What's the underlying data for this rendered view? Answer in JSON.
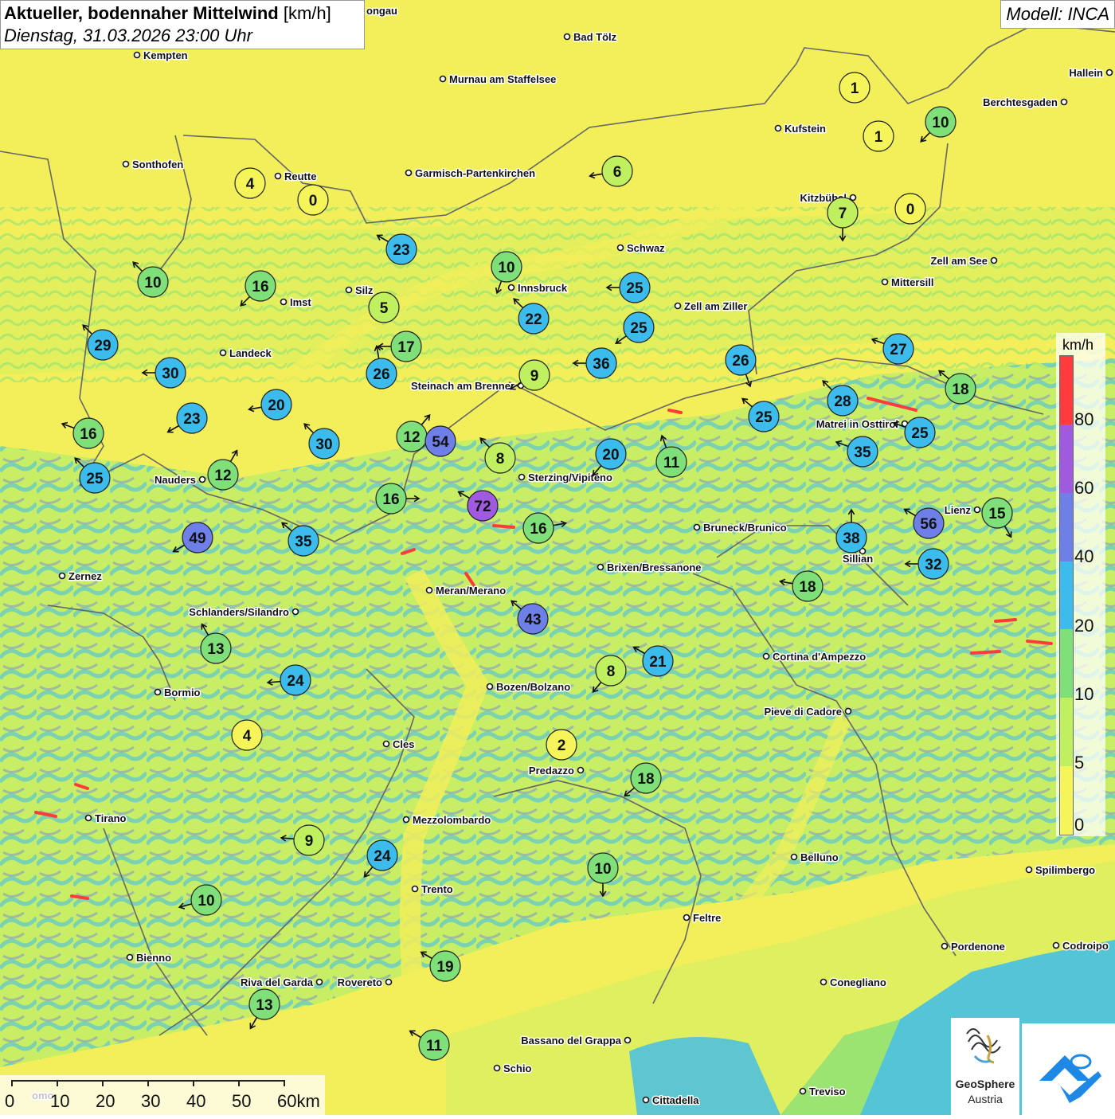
{
  "title": {
    "main": "Aktueller, bodennaher Mittelwind",
    "unit": "[km/h]",
    "datetime": "Dienstag, 31.03.2026 23:00 Uhr"
  },
  "model_label": "Modell: INCA",
  "legend": {
    "title": "km/h",
    "ticks": [
      "0",
      "5",
      "10",
      "20",
      "40",
      "60",
      "80"
    ],
    "colors": [
      "#f5f55a",
      "#bff060",
      "#7fe07a",
      "#3cbcec",
      "#6f7fe8",
      "#9f5ae0",
      "#ff3b3b"
    ]
  },
  "scale_bar": {
    "labels": [
      "0",
      "10",
      "20",
      "30",
      "40",
      "50",
      "60km"
    ]
  },
  "logo": {
    "name": "GeoSphere",
    "sub": "Austria"
  },
  "partial_labels": [
    "ongau",
    "omo"
  ],
  "cities": [
    "Kempten",
    "Bad Tölz",
    "Murnau am Staffelsee",
    "Hallein",
    "Berchtesgaden",
    "Kufstein",
    "Sonthofen",
    "Reutte",
    "Garmisch-Partenkirchen",
    "Kitzbühel",
    "Schwaz",
    "Zell am See",
    "Mittersill",
    "Innsbruck",
    "Silz",
    "Imst",
    "Zell am Ziller",
    "Landeck",
    "Steinach am Brenner",
    "Matrei in Osttirol",
    "Nauders",
    "Sterzing/Vipiteno",
    "Lienz",
    "Bruneck/Brunico",
    "Sillian",
    "Brixen/Bressanone",
    "Zernez",
    "Meran/Merano",
    "Schlanders/Silandro",
    "Cortina d'Ampezzo",
    "Bormio",
    "Bozen/Bolzano",
    "Pieve di Cadore",
    "Cles",
    "Predazzo",
    "Tirano",
    "Mezzolombardo",
    "Belluno",
    "Spilimbergo",
    "Trento",
    "Feltre",
    "Pordenone",
    "Codroipo",
    "Bienno",
    "Riva del Garda",
    "Rovereto",
    "Conegliano",
    "Bassano del Grappa",
    "Schio",
    "Cittadella",
    "Treviso"
  ],
  "wind_stations": [
    {
      "speed": 1,
      "direction_deg": null
    },
    {
      "speed": 1,
      "direction_deg": null
    },
    {
      "speed": 10,
      "direction_deg": 225
    },
    {
      "speed": 6,
      "direction_deg": 260
    },
    {
      "speed": 4,
      "direction_deg": null
    },
    {
      "speed": 0,
      "direction_deg": null
    },
    {
      "speed": 7,
      "direction_deg": 180
    },
    {
      "speed": 0,
      "direction_deg": null
    },
    {
      "speed": 23,
      "direction_deg": 300
    },
    {
      "speed": 10,
      "direction_deg": 200
    },
    {
      "speed": 25,
      "direction_deg": 270
    },
    {
      "speed": 10,
      "direction_deg": 315
    },
    {
      "speed": 16,
      "direction_deg": 225
    },
    {
      "speed": 5,
      "direction_deg": null
    },
    {
      "speed": 22,
      "direction_deg": 315
    },
    {
      "speed": 25,
      "direction_deg": 235
    },
    {
      "speed": 29,
      "direction_deg": 315
    },
    {
      "speed": 17,
      "direction_deg": 270
    },
    {
      "speed": 26,
      "direction_deg": 350
    },
    {
      "speed": 30,
      "direction_deg": 270
    },
    {
      "speed": 9,
      "direction_deg": 240
    },
    {
      "speed": 36,
      "direction_deg": 270
    },
    {
      "speed": 26,
      "direction_deg": 160
    },
    {
      "speed": 27,
      "direction_deg": 290
    },
    {
      "speed": 18,
      "direction_deg": 310
    },
    {
      "speed": 20,
      "direction_deg": 260
    },
    {
      "speed": 28,
      "direction_deg": 315
    },
    {
      "speed": 25,
      "direction_deg": 310
    },
    {
      "speed": 23,
      "direction_deg": 240
    },
    {
      "speed": 16,
      "direction_deg": 290
    },
    {
      "speed": 30,
      "direction_deg": 315
    },
    {
      "speed": 12,
      "direction_deg": 40
    },
    {
      "speed": 54,
      "direction_deg": null
    },
    {
      "speed": 8,
      "direction_deg": 315
    },
    {
      "speed": 20,
      "direction_deg": 220
    },
    {
      "speed": 11,
      "direction_deg": 340
    },
    {
      "speed": 35,
      "direction_deg": 290
    },
    {
      "speed": 25,
      "direction_deg": 290
    },
    {
      "speed": 25,
      "direction_deg": 315
    },
    {
      "speed": 12,
      "direction_deg": 30
    },
    {
      "speed": 16,
      "direction_deg": 90
    },
    {
      "speed": 72,
      "direction_deg": 300
    },
    {
      "speed": 16,
      "direction_deg": 80
    },
    {
      "speed": 56,
      "direction_deg": 300
    },
    {
      "speed": 15,
      "direction_deg": 150
    },
    {
      "speed": 49,
      "direction_deg": 240
    },
    {
      "speed": 35,
      "direction_deg": 310
    },
    {
      "speed": 38,
      "direction_deg": 0
    },
    {
      "speed": 32,
      "direction_deg": 270
    },
    {
      "speed": 18,
      "direction_deg": 280
    },
    {
      "speed": 43,
      "direction_deg": 310
    },
    {
      "speed": 13,
      "direction_deg": 330
    },
    {
      "speed": 21,
      "direction_deg": 300
    },
    {
      "speed": 8,
      "direction_deg": 220
    },
    {
      "speed": 24,
      "direction_deg": 265
    },
    {
      "speed": 4,
      "direction_deg": null
    },
    {
      "speed": 2,
      "direction_deg": null
    },
    {
      "speed": 18,
      "direction_deg": 230
    },
    {
      "speed": 9,
      "direction_deg": 275
    },
    {
      "speed": 24,
      "direction_deg": 220
    },
    {
      "speed": 10,
      "direction_deg": 180
    },
    {
      "speed": 10,
      "direction_deg": 255
    },
    {
      "speed": 19,
      "direction_deg": 300
    },
    {
      "speed": 13,
      "direction_deg": 210
    },
    {
      "speed": 11,
      "direction_deg": 300
    }
  ]
}
